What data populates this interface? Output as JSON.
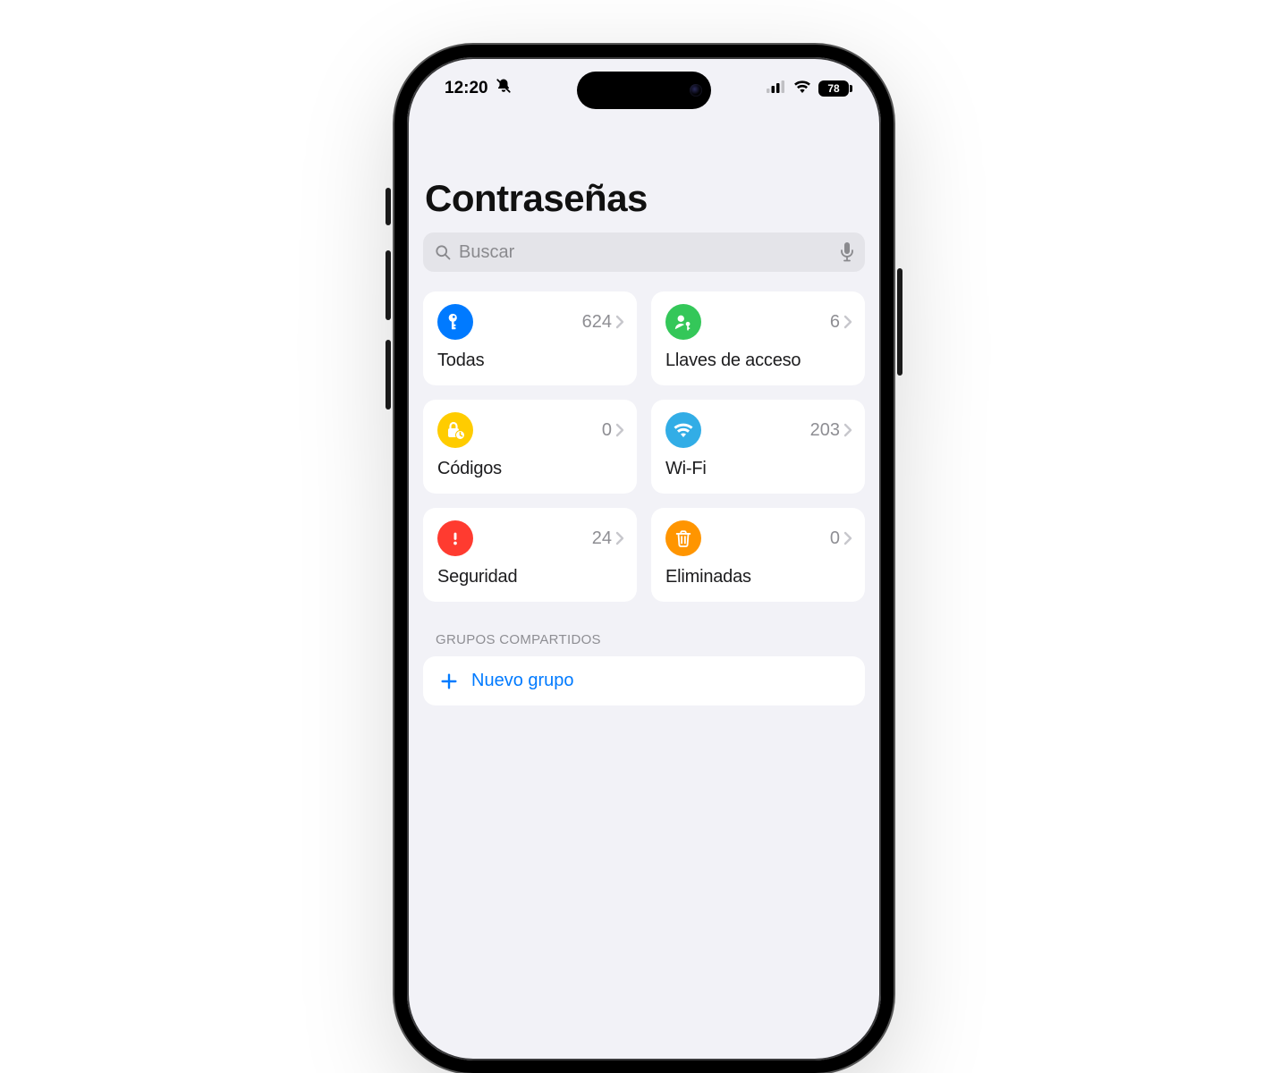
{
  "status_bar": {
    "time": "12:20",
    "battery_level": "78"
  },
  "header": {
    "title": "Contraseñas"
  },
  "search": {
    "placeholder": "Buscar"
  },
  "tiles": [
    {
      "id": "all",
      "label": "Todas",
      "count": "624",
      "icon": "key-icon",
      "color": "bg-blue"
    },
    {
      "id": "passkeys",
      "label": "Llaves de acceso",
      "count": "6",
      "icon": "person-icon",
      "color": "bg-green"
    },
    {
      "id": "codes",
      "label": "Códigos",
      "count": "0",
      "icon": "lock-icon",
      "color": "bg-yellow"
    },
    {
      "id": "wifi",
      "label": "Wi-Fi",
      "count": "203",
      "icon": "wifi-icon",
      "color": "bg-sky"
    },
    {
      "id": "security",
      "label": "Seguridad",
      "count": "24",
      "icon": "alert-icon",
      "color": "bg-red"
    },
    {
      "id": "deleted",
      "label": "Eliminadas",
      "count": "0",
      "icon": "trash-icon",
      "color": "bg-orange"
    }
  ],
  "groups": {
    "section_label": "Grupos compartidos",
    "new_group_label": "Nuevo grupo"
  },
  "colors": {
    "accent": "#007aff"
  }
}
